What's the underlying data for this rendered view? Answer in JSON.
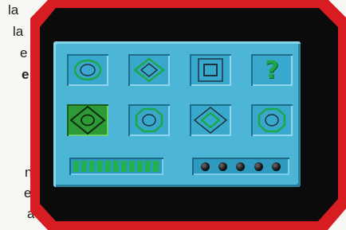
{
  "side_text": [
    "la",
    "la",
    "e",
    "e",
    "n",
    "es",
    "a"
  ],
  "colors": {
    "frame_red": "#d71c22",
    "frame_black": "#0b0b0b",
    "panel_blue": "#4db6d6",
    "shape_green": "#1aa84b",
    "selected_tile": "#2e9a36"
  },
  "board": {
    "tiles": [
      {
        "shape": "circle",
        "selected": false
      },
      {
        "shape": "diamond",
        "selected": false
      },
      {
        "shape": "square",
        "selected": false
      },
      {
        "shape": "question-mark",
        "label": "?",
        "selected": false
      },
      {
        "shape": "diamond-circle",
        "selected": true
      },
      {
        "shape": "octagon",
        "selected": false
      },
      {
        "shape": "diamond",
        "selected": false
      },
      {
        "shape": "octagon",
        "selected": false
      }
    ],
    "energy_meter": {
      "segments_total": 11,
      "segments_lit": 11
    },
    "lives": {
      "count": 5
    }
  }
}
